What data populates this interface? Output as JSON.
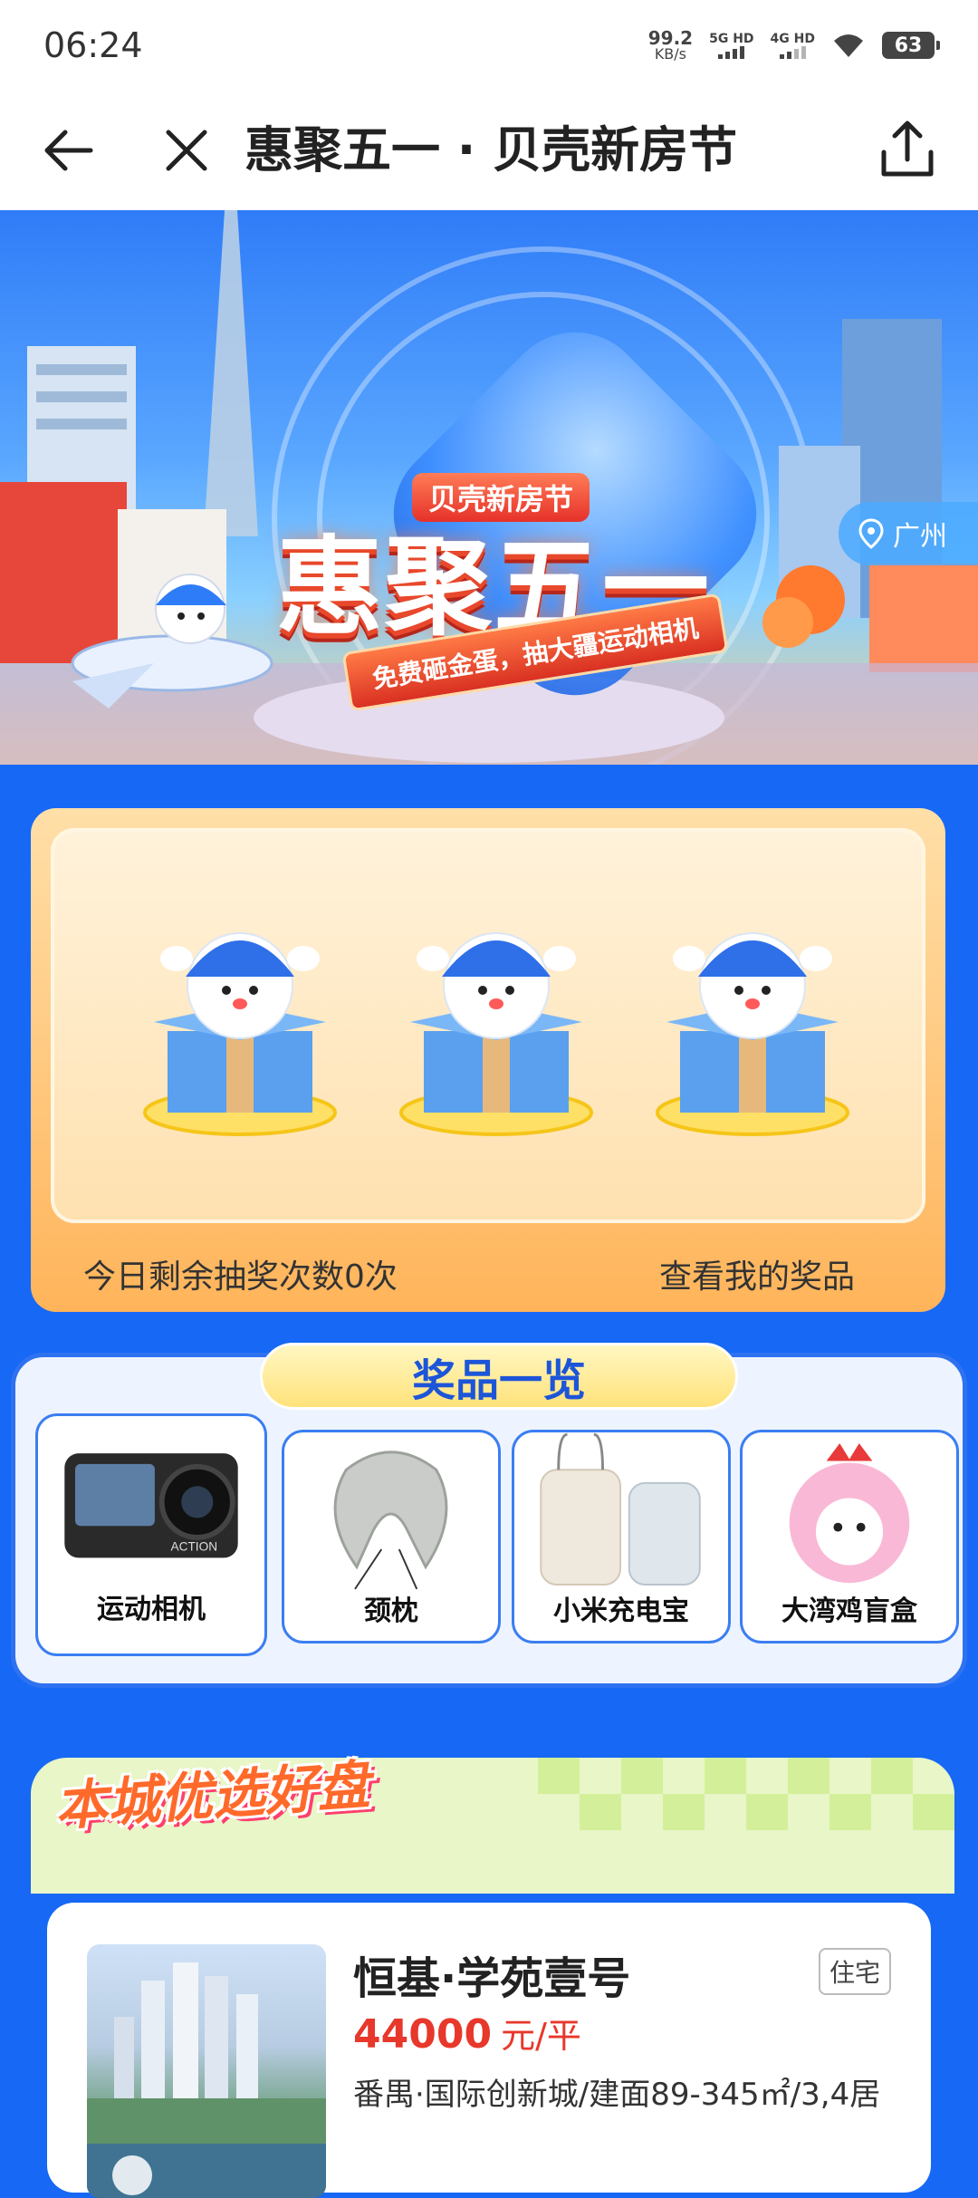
{
  "status_bar": {
    "time": "06:24",
    "net_speed_value": "99.2",
    "net_speed_unit": "KB/s",
    "signal_1_label": "5G HD",
    "signal_2_label": "4G HD",
    "battery": "63"
  },
  "nav": {
    "title": "惠聚五一 · 贝壳新房节"
  },
  "hero": {
    "subtitle": "贝壳新房节",
    "headline": "惠聚五一",
    "ribbon": "免费砸金蛋，抽大疆运动相机",
    "location": "广州"
  },
  "lottery": {
    "remaining_text": "今日剩余抽奖次数0次",
    "my_prizes_link": "查看我的奖品"
  },
  "prizes": {
    "title": "奖品一览",
    "items": [
      {
        "name": "运动相机",
        "icon": "action-camera-icon",
        "brand_text": "ACTION"
      },
      {
        "name": "颈枕",
        "icon": "neck-pillow-icon"
      },
      {
        "name": "小米充电宝",
        "icon": "power-bank-icon"
      },
      {
        "name": "大湾鸡盲盒",
        "icon": "blind-box-toy-icon"
      }
    ]
  },
  "recommended": {
    "title": "本城优选好盘",
    "listing": {
      "name": "恒基·学苑壹号",
      "tag": "住宅",
      "price": "44000",
      "price_unit": "元/平",
      "desc": "番禺·国际创新城/建面89-345㎡/3,4居"
    }
  },
  "colors": {
    "page_bg": "#1668f5",
    "price_red": "#e8372b",
    "prize_title_blue": "#1d55d8",
    "accent_orange": "#ff6a2b"
  }
}
